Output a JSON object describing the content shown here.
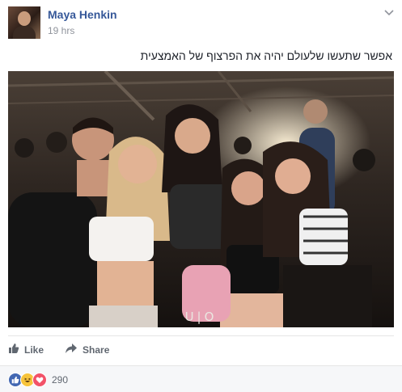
{
  "post": {
    "author": "Maya Henkin",
    "timestamp": "19 hrs",
    "privacy_icon": "globe-icon",
    "text": "אפשר שתעשו שלעולם יהיה את הפרצוף של האמצעית"
  },
  "photo": {
    "watermark": "U|O"
  },
  "actions": {
    "like_label": "Like",
    "share_label": "Share"
  },
  "reactions": {
    "icons": [
      "like-icon",
      "haha-icon",
      "love-icon"
    ],
    "count": "290"
  },
  "colors": {
    "name_blue": "#365899",
    "muted": "#90949c",
    "like_blue": "#4267b2",
    "love_red": "#f25268",
    "haha_yellow": "#f7c43b"
  }
}
